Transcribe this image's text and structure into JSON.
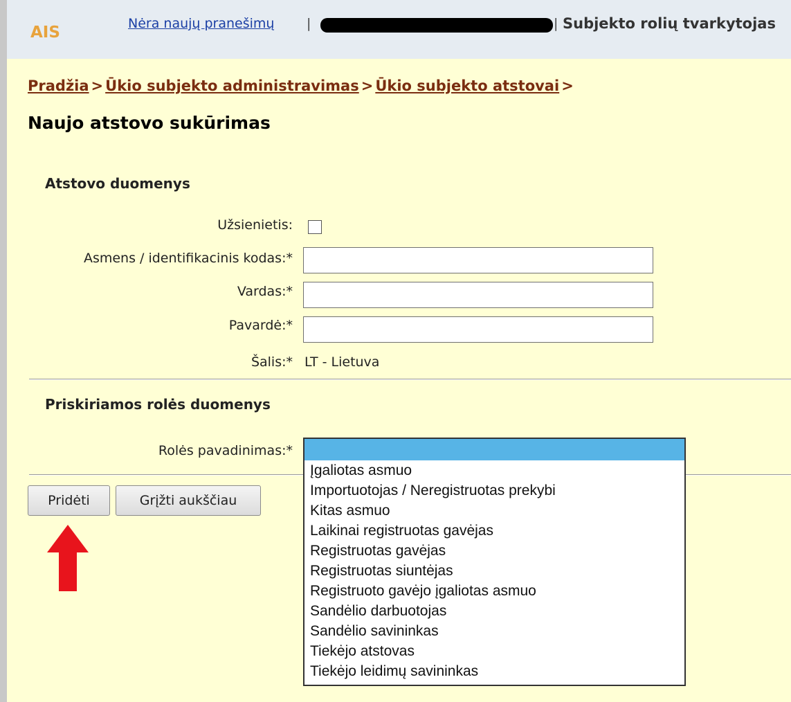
{
  "header": {
    "logo": "AIS",
    "messages_link": "Nėra naujų pranešimų",
    "separator": "|",
    "role_title": "Subjekto rolių tvarkytojas"
  },
  "breadcrumb": {
    "items": [
      "Pradžia",
      "Ūkio subjekto administravimas",
      "Ūkio subjekto atstovai"
    ],
    "separator": ">"
  },
  "page_title": "Naujo atstovo sukūrimas",
  "representative_section": {
    "title": "Atstovo duomenys",
    "foreigner_label": "Užsienietis:",
    "code_label": "Asmens / identifikacinis kodas:*",
    "code_value": "",
    "first_name_label": "Vardas:*",
    "first_name_value": "",
    "last_name_label": "Pavardė:*",
    "last_name_value": "",
    "country_label": "Šalis:*",
    "country_value": "LT - Lietuva"
  },
  "role_section": {
    "title": "Priskiriamos rolės duomenys",
    "role_label": "Rolės pavadinimas:*",
    "role_options": [
      "",
      "Įgaliotas asmuo",
      "Importuotojas / Neregistruotas prekybi",
      "Kitas asmuo",
      "Laikinai registruotas gavėjas",
      "Registruotas gavėjas",
      "Registruotas siuntėjas",
      "Registruoto gavėjo įgaliotas asmuo",
      "Sandėlio darbuotojas",
      "Sandėlio savininkas",
      "Tiekėjo atstovas",
      "Tiekėjo leidimų savininkas"
    ]
  },
  "buttons": {
    "add": "Pridėti",
    "back": "Grįžti aukščiau"
  },
  "colors": {
    "logo": "#e8a33d",
    "breadcrumb": "#7a2d10",
    "content_bg": "#ffffd5",
    "header_bg": "#e6ecf2",
    "dropdown_highlight": "#57b4e6",
    "arrow": "#e8141c"
  }
}
